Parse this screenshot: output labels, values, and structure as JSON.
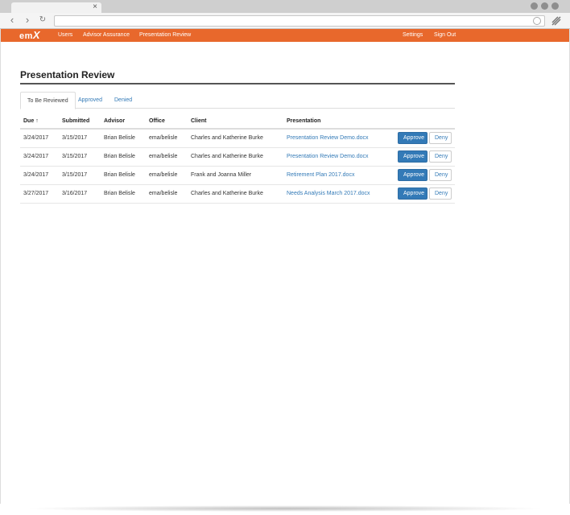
{
  "browser": {
    "tab_close": "×",
    "back": "‹",
    "forward": "›",
    "reload": "↻"
  },
  "appnav": {
    "logo_main": "em",
    "logo_x": "X",
    "links": [
      "Users",
      "Advisor Assurance",
      "Presentation Review"
    ],
    "right_links": [
      "Settings",
      "Sign Out"
    ],
    "color": "#e8682c"
  },
  "page": {
    "title": "Presentation Review"
  },
  "tabs": [
    {
      "label": "To Be Reviewed",
      "active": true
    },
    {
      "label": "Approved",
      "active": false
    },
    {
      "label": "Denied",
      "active": false
    }
  ],
  "table": {
    "headers": [
      "Due",
      "Submitted",
      "Advisor",
      "Office",
      "Client",
      "Presentation"
    ],
    "sort_indicator": "↑",
    "rows": [
      {
        "due": "3/24/2017",
        "submitted": "3/15/2017",
        "advisor": "Brian Belisle",
        "office": "ema/belisle",
        "client": "Charles and Katherine Burke",
        "presentation": "Presentation Review Demo.docx"
      },
      {
        "due": "3/24/2017",
        "submitted": "3/15/2017",
        "advisor": "Brian Belisle",
        "office": "ema/belisle",
        "client": "Charles and Katherine Burke",
        "presentation": "Presentation Review Demo.docx"
      },
      {
        "due": "3/24/2017",
        "submitted": "3/15/2017",
        "advisor": "Brian Belisle",
        "office": "ema/belisle",
        "client": "Frank and Joanna Miller",
        "presentation": "Retirement Plan 2017.docx"
      },
      {
        "due": "3/27/2017",
        "submitted": "3/16/2017",
        "advisor": "Brian Belisle",
        "office": "ema/belisle",
        "client": "Charles and Katherine Burke",
        "presentation": "Needs Analysis March 2017.docx"
      }
    ],
    "approve_label": "Approve",
    "deny_label": "Deny"
  }
}
